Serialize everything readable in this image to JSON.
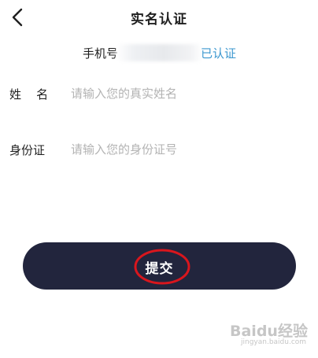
{
  "header": {
    "title": "实名认证",
    "back_icon": "chevron-left-icon"
  },
  "phone": {
    "label": "手机号",
    "verified_text": "已认证"
  },
  "form": {
    "name": {
      "label": "姓    名",
      "placeholder": "请输入您的真实姓名",
      "value": ""
    },
    "id_card": {
      "label": "身份证",
      "placeholder": "请输入您的身份证号",
      "value": ""
    }
  },
  "submit": {
    "label": "提交"
  },
  "watermark": {
    "text": "Baidu经验",
    "sub": "jingyan.baidu.com"
  },
  "colors": {
    "accent": "#3b97cf",
    "button_bg": "#22253d",
    "annotation": "#d9161d",
    "placeholder": "#b3b3b3"
  }
}
